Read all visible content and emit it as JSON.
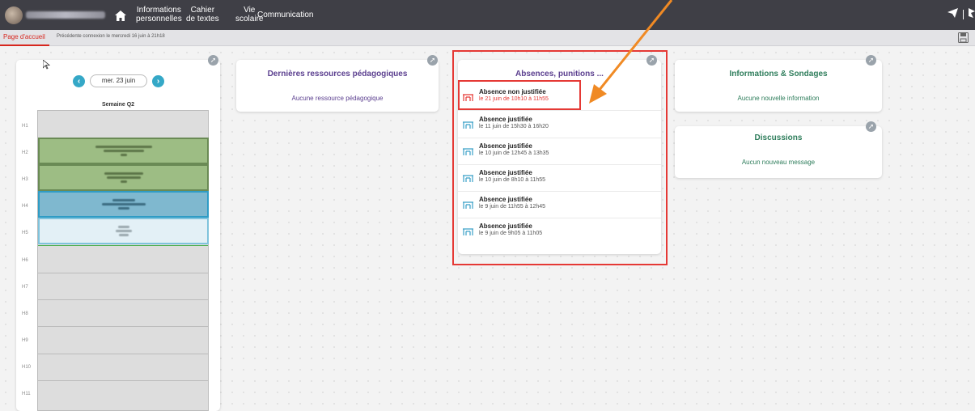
{
  "topbar": {
    "nav": [
      {
        "label": "Informations\npersonnelles"
      },
      {
        "label": "Cahier\nde textes"
      },
      {
        "label": "Vie\nscolaire"
      },
      {
        "label": "Communication"
      }
    ]
  },
  "subbar": {
    "active_tab": "Page d'accueil",
    "last_connection": "Précédente connexion le mercredi 16 juin à 21h18"
  },
  "edt": {
    "date": "mer. 23 juin",
    "prev_label": "‹",
    "next_label": "›",
    "week": "Semaine Q2",
    "hours": [
      "H1",
      "H2",
      "H3",
      "H4",
      "H5",
      "H6",
      "H7",
      "H8",
      "H9",
      "H10",
      "H11"
    ]
  },
  "ressources": {
    "title": "Dernières ressources pédagogiques",
    "empty": "Aucune ressource pédagogique"
  },
  "absences": {
    "title": "Absences, punitions ...",
    "items": [
      {
        "title": "Absence non justifiée",
        "detail": "le 21 juin de 10h10 à 11h55"
      },
      {
        "title": "Absence justifiée",
        "detail": "le 11 juin de 15h30 à 16h20"
      },
      {
        "title": "Absence justifiée",
        "detail": "le 10 juin de 12h45 à 13h35"
      },
      {
        "title": "Absence justifiée",
        "detail": "le 10 juin de 8h10 à 11h55"
      },
      {
        "title": "Absence justifiée",
        "detail": "le 9 juin de 11h55 à 12h45"
      },
      {
        "title": "Absence justifiée",
        "detail": "le 9 juin de 9h05 à 11h05"
      }
    ]
  },
  "infos": {
    "title": "Informations & Sondages",
    "empty": "Aucune nouvelle information"
  },
  "discussions": {
    "title": "Discussions",
    "empty": "Aucun nouveau message"
  },
  "colors": {
    "purple_title": "#5b3f8f",
    "green_title": "#2e7d5b",
    "alert_red": "#e53935",
    "arrow_orange": "#f08a24",
    "accent_blue": "#35a8c7"
  }
}
